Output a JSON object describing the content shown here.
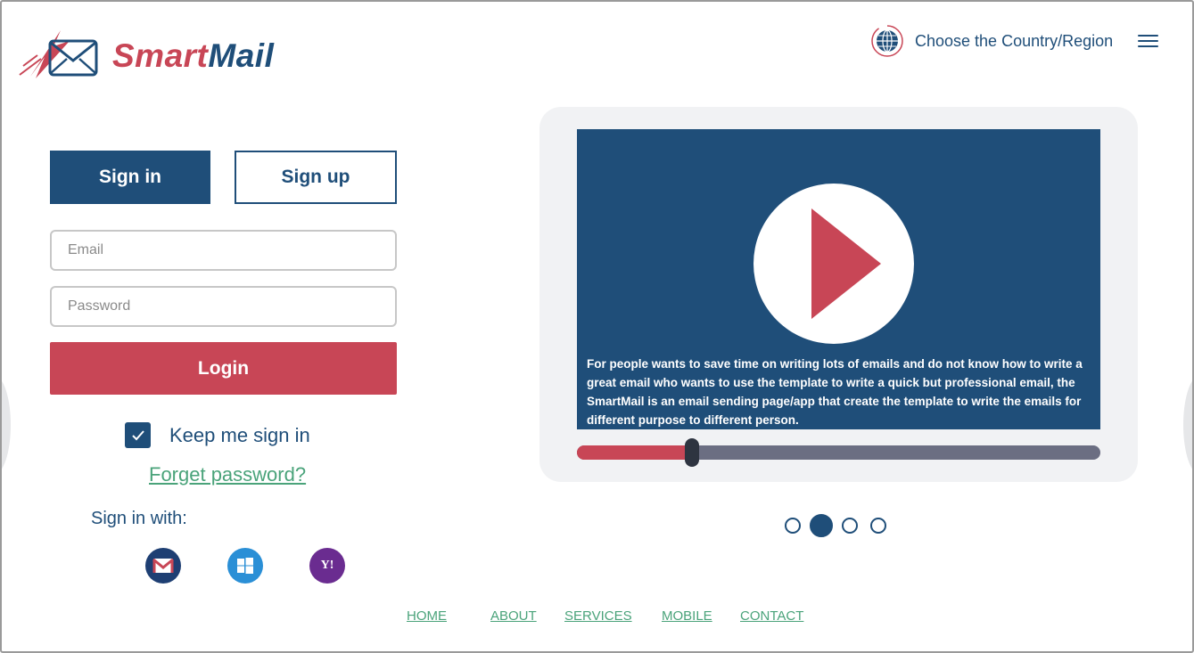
{
  "brand": {
    "part1": "Smart",
    "part2": "Mail"
  },
  "header": {
    "region_label": "Choose the Country/Region",
    "icons": [
      "globe-icon",
      "menu-icon"
    ]
  },
  "auth": {
    "signin_tab": "Sign in",
    "signup_tab": "Sign up",
    "email_placeholder": "Email",
    "email_value": "",
    "password_placeholder": "Password",
    "password_value": "",
    "login_label": "Login",
    "keep_signed_in_label": "Keep me sign in",
    "keep_signed_in_checked": true,
    "forget_password_label": "Forget password?",
    "sign_in_with_label": "Sign in with:",
    "providers": [
      "gmail-icon",
      "windows-icon",
      "yahoo-icon"
    ],
    "yahoo_glyph": "Y!"
  },
  "video": {
    "caption": "For people wants to save time on writing lots of emails and do not know how to write a great email who wants to use the template to write a quick but professional email, the SmartMail is an email sending page/app that create the template to write the emails for different purpose to different person.",
    "progress": 0.22
  },
  "carousel": {
    "count": 4,
    "active_index": 1
  },
  "footer": {
    "links": [
      "HOME",
      "ABOUT",
      "SERVICES",
      "MOBILE",
      "CONTACT"
    ]
  },
  "colors": {
    "primary": "#1f4e79",
    "accent": "#c84656",
    "link_green": "#4aa37a",
    "track_gray": "#6b6e82"
  }
}
